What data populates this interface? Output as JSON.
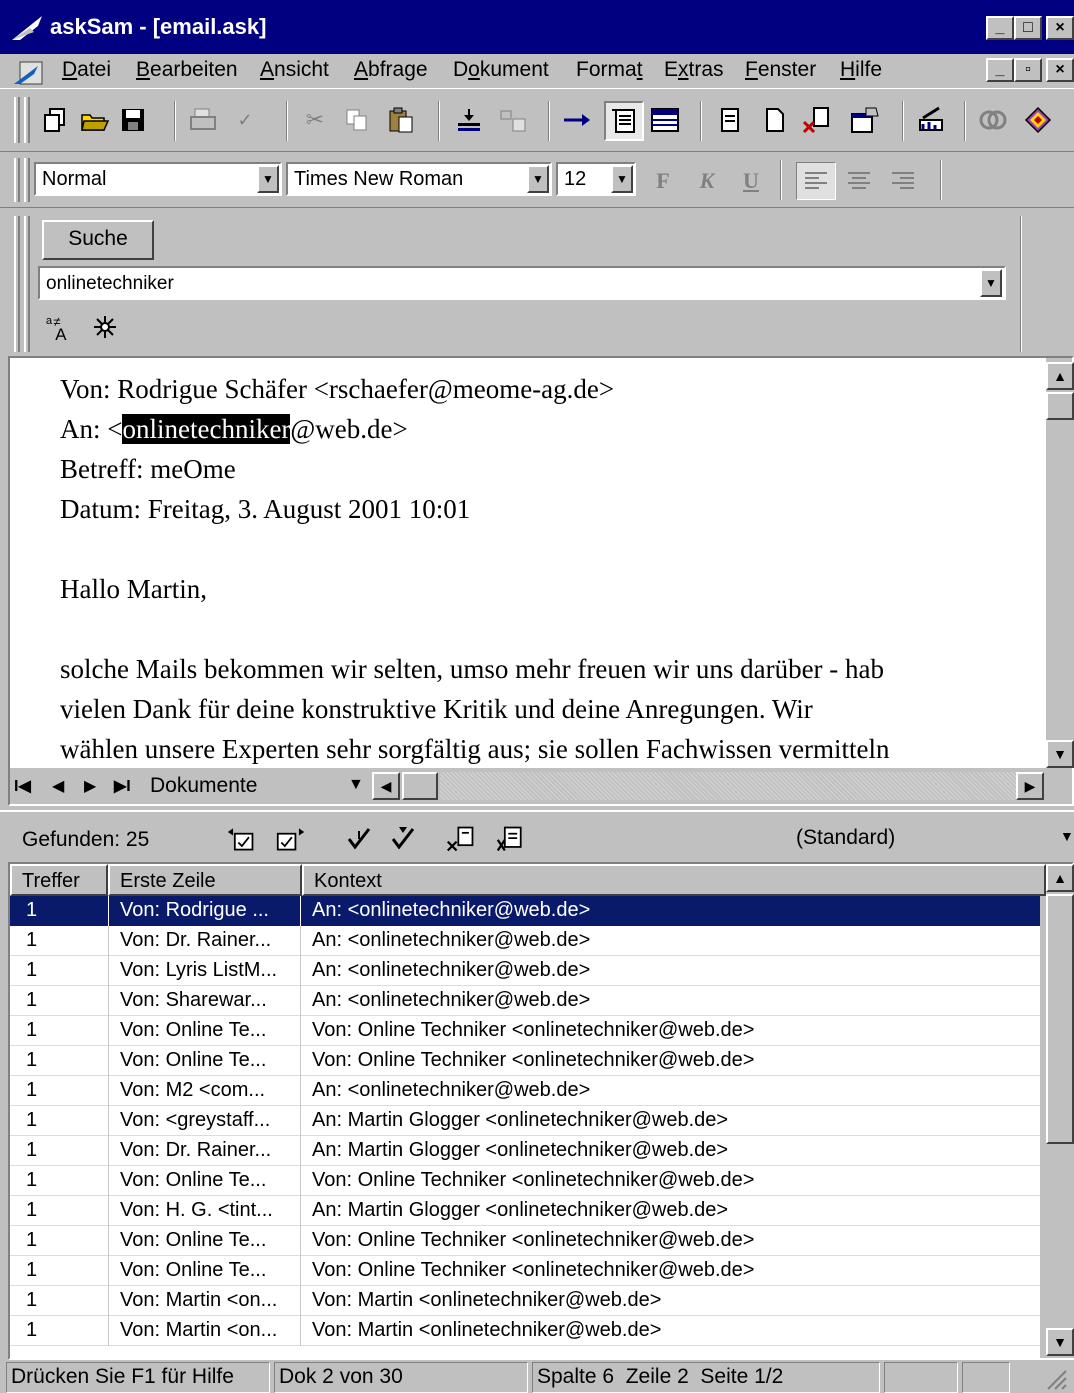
{
  "window": {
    "title": "askSam - [email.ask]",
    "buttons": {
      "minimize": "_",
      "maximize": "□",
      "close": "×"
    },
    "doc_buttons": {
      "minimize": "_",
      "restore": "▫",
      "close": "×"
    }
  },
  "menu": {
    "items": [
      "Datei",
      "Bearbeiten",
      "Ansicht",
      "Abfrage",
      "Dokument",
      "Format",
      "Extras",
      "Fenster",
      "Hilfe"
    ]
  },
  "format_bar": {
    "style": "Normal",
    "font": "Times New Roman",
    "size": "12",
    "bold": "F",
    "italic": "K",
    "underline": "U"
  },
  "search": {
    "button_label": "Suche",
    "query": "onlinetechniker"
  },
  "document": {
    "from": "Von: Rodrigue Schäfer <rschaefer@meome-ag.de>",
    "to_prefix": "An: <",
    "to_highlight": "onlinetechniker",
    "to_suffix": "@web.de>",
    "subject": "Betreff: meOme",
    "date": "Datum: Freitag, 3. August 2001 10:01",
    "greeting": "Hallo Martin,",
    "body_lines": [
      "solche Mails bekommen wir selten, umso mehr freuen wir uns darüber - hab",
      "vielen Dank für deine konstruktive Kritik und deine Anregungen. Wir",
      "wählen unsere Experten sehr sorgfältig aus; sie sollen Fachwissen vermitteln"
    ]
  },
  "doc_nav": {
    "first": "I◀",
    "prev": "◀",
    "next": "▶",
    "last": "▶I",
    "label": "Dokumente"
  },
  "results": {
    "found_label": "Gefunden: 25",
    "view_select": "(Standard)",
    "columns": [
      "Treffer",
      "Erste Zeile",
      "Kontext"
    ],
    "rows": [
      [
        "1",
        "Von: Rodrigue ...",
        "An: <onlinetechniker@web.de>"
      ],
      [
        "1",
        "Von: Dr. Rainer...",
        "An: <onlinetechniker@web.de>"
      ],
      [
        "1",
        "Von: Lyris ListM...",
        "An: <onlinetechniker@web.de>"
      ],
      [
        "1",
        "Von: Sharewar...",
        "An: <onlinetechniker@web.de>"
      ],
      [
        "1",
        "Von: Online Te...",
        "Von: Online Techniker <onlinetechniker@web.de>"
      ],
      [
        "1",
        "Von: Online Te...",
        "Von: Online Techniker <onlinetechniker@web.de>"
      ],
      [
        "1",
        "Von: M2 <com...",
        "An: <onlinetechniker@web.de>"
      ],
      [
        "1",
        "Von: <greystaff...",
        "An: Martin Glogger <onlinetechniker@web.de>"
      ],
      [
        "1",
        "Von: Dr. Rainer...",
        "An: Martin Glogger <onlinetechniker@web.de>"
      ],
      [
        "1",
        "Von: Online Te...",
        "Von: Online Techniker <onlinetechniker@web.de>"
      ],
      [
        "1",
        "Von: H. G. <tint...",
        "An: Martin Glogger <onlinetechniker@web.de>"
      ],
      [
        "1",
        "Von: Online Te...",
        "Von: Online Techniker <onlinetechniker@web.de>"
      ],
      [
        "1",
        "Von: Online Te...",
        "Von: Online Techniker <onlinetechniker@web.de>"
      ],
      [
        "1",
        "Von: Martin <on...",
        "Von: Martin <onlinetechniker@web.de>"
      ],
      [
        "1",
        "Von: Martin <on...",
        "Von: Martin <onlinetechniker@web.de>"
      ]
    ]
  },
  "status": {
    "help": "Drücken Sie F1 für Hilfe",
    "doc": "Dok 2 von 30",
    "position": "Spalte 6  Zeile 2  Seite 1/2"
  },
  "colors": {
    "title_bar": "#000080",
    "selection": "#0a1a6a",
    "face": "#c0c0c0"
  },
  "icons": [
    "new-icon",
    "open-folder-icon",
    "save-icon",
    "print-icon",
    "spellcheck-icon",
    "cut-icon",
    "copy-icon",
    "paste-icon",
    "insert-icon",
    "fields-icon",
    "arrow-right-icon",
    "document-view-icon",
    "table-view-icon",
    "page-icon",
    "blank-page-icon",
    "delete-doc-icon",
    "properties-icon",
    "report-icon",
    "wizard-icon",
    "book-icon",
    "case-sensitive-icon",
    "fuzzy-search-icon"
  ]
}
